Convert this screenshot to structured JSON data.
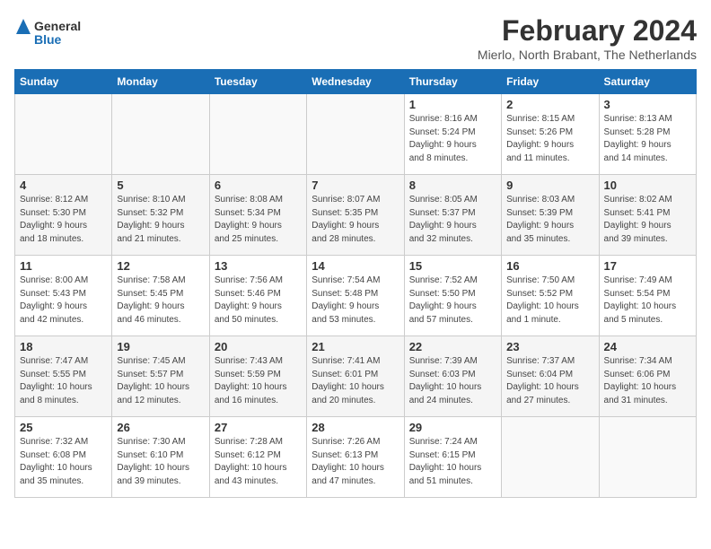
{
  "header": {
    "logo_line1": "General",
    "logo_line2": "Blue",
    "month_year": "February 2024",
    "location": "Mierlo, North Brabant, The Netherlands"
  },
  "weekdays": [
    "Sunday",
    "Monday",
    "Tuesday",
    "Wednesday",
    "Thursday",
    "Friday",
    "Saturday"
  ],
  "weeks": [
    [
      {
        "day": "",
        "info": ""
      },
      {
        "day": "",
        "info": ""
      },
      {
        "day": "",
        "info": ""
      },
      {
        "day": "",
        "info": ""
      },
      {
        "day": "1",
        "info": "Sunrise: 8:16 AM\nSunset: 5:24 PM\nDaylight: 9 hours\nand 8 minutes."
      },
      {
        "day": "2",
        "info": "Sunrise: 8:15 AM\nSunset: 5:26 PM\nDaylight: 9 hours\nand 11 minutes."
      },
      {
        "day": "3",
        "info": "Sunrise: 8:13 AM\nSunset: 5:28 PM\nDaylight: 9 hours\nand 14 minutes."
      }
    ],
    [
      {
        "day": "4",
        "info": "Sunrise: 8:12 AM\nSunset: 5:30 PM\nDaylight: 9 hours\nand 18 minutes."
      },
      {
        "day": "5",
        "info": "Sunrise: 8:10 AM\nSunset: 5:32 PM\nDaylight: 9 hours\nand 21 minutes."
      },
      {
        "day": "6",
        "info": "Sunrise: 8:08 AM\nSunset: 5:34 PM\nDaylight: 9 hours\nand 25 minutes."
      },
      {
        "day": "7",
        "info": "Sunrise: 8:07 AM\nSunset: 5:35 PM\nDaylight: 9 hours\nand 28 minutes."
      },
      {
        "day": "8",
        "info": "Sunrise: 8:05 AM\nSunset: 5:37 PM\nDaylight: 9 hours\nand 32 minutes."
      },
      {
        "day": "9",
        "info": "Sunrise: 8:03 AM\nSunset: 5:39 PM\nDaylight: 9 hours\nand 35 minutes."
      },
      {
        "day": "10",
        "info": "Sunrise: 8:02 AM\nSunset: 5:41 PM\nDaylight: 9 hours\nand 39 minutes."
      }
    ],
    [
      {
        "day": "11",
        "info": "Sunrise: 8:00 AM\nSunset: 5:43 PM\nDaylight: 9 hours\nand 42 minutes."
      },
      {
        "day": "12",
        "info": "Sunrise: 7:58 AM\nSunset: 5:45 PM\nDaylight: 9 hours\nand 46 minutes."
      },
      {
        "day": "13",
        "info": "Sunrise: 7:56 AM\nSunset: 5:46 PM\nDaylight: 9 hours\nand 50 minutes."
      },
      {
        "day": "14",
        "info": "Sunrise: 7:54 AM\nSunset: 5:48 PM\nDaylight: 9 hours\nand 53 minutes."
      },
      {
        "day": "15",
        "info": "Sunrise: 7:52 AM\nSunset: 5:50 PM\nDaylight: 9 hours\nand 57 minutes."
      },
      {
        "day": "16",
        "info": "Sunrise: 7:50 AM\nSunset: 5:52 PM\nDaylight: 10 hours\nand 1 minute."
      },
      {
        "day": "17",
        "info": "Sunrise: 7:49 AM\nSunset: 5:54 PM\nDaylight: 10 hours\nand 5 minutes."
      }
    ],
    [
      {
        "day": "18",
        "info": "Sunrise: 7:47 AM\nSunset: 5:55 PM\nDaylight: 10 hours\nand 8 minutes."
      },
      {
        "day": "19",
        "info": "Sunrise: 7:45 AM\nSunset: 5:57 PM\nDaylight: 10 hours\nand 12 minutes."
      },
      {
        "day": "20",
        "info": "Sunrise: 7:43 AM\nSunset: 5:59 PM\nDaylight: 10 hours\nand 16 minutes."
      },
      {
        "day": "21",
        "info": "Sunrise: 7:41 AM\nSunset: 6:01 PM\nDaylight: 10 hours\nand 20 minutes."
      },
      {
        "day": "22",
        "info": "Sunrise: 7:39 AM\nSunset: 6:03 PM\nDaylight: 10 hours\nand 24 minutes."
      },
      {
        "day": "23",
        "info": "Sunrise: 7:37 AM\nSunset: 6:04 PM\nDaylight: 10 hours\nand 27 minutes."
      },
      {
        "day": "24",
        "info": "Sunrise: 7:34 AM\nSunset: 6:06 PM\nDaylight: 10 hours\nand 31 minutes."
      }
    ],
    [
      {
        "day": "25",
        "info": "Sunrise: 7:32 AM\nSunset: 6:08 PM\nDaylight: 10 hours\nand 35 minutes."
      },
      {
        "day": "26",
        "info": "Sunrise: 7:30 AM\nSunset: 6:10 PM\nDaylight: 10 hours\nand 39 minutes."
      },
      {
        "day": "27",
        "info": "Sunrise: 7:28 AM\nSunset: 6:12 PM\nDaylight: 10 hours\nand 43 minutes."
      },
      {
        "day": "28",
        "info": "Sunrise: 7:26 AM\nSunset: 6:13 PM\nDaylight: 10 hours\nand 47 minutes."
      },
      {
        "day": "29",
        "info": "Sunrise: 7:24 AM\nSunset: 6:15 PM\nDaylight: 10 hours\nand 51 minutes."
      },
      {
        "day": "",
        "info": ""
      },
      {
        "day": "",
        "info": ""
      }
    ]
  ]
}
